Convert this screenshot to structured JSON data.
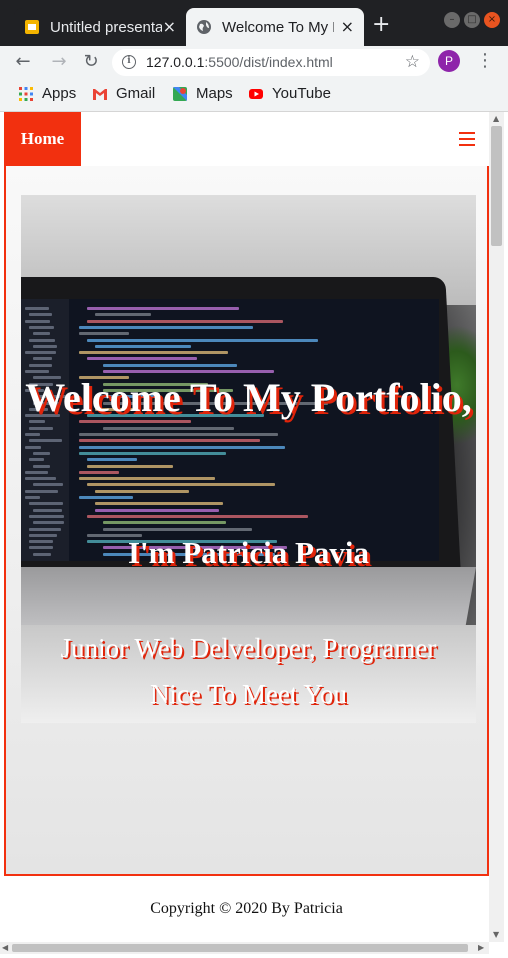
{
  "browser": {
    "tabs": [
      {
        "title": "Untitled presentation",
        "active": false,
        "icon": "slides-icon"
      },
      {
        "title": "Welcome To My Portfolio",
        "active": true,
        "icon": "globe-icon"
      }
    ],
    "new_tab": "+",
    "close_glyph": "×",
    "url_host": "127.0.0.1",
    "url_rest": ":5500/dist/index.html",
    "profile_initial": "P",
    "profile_color": "#8e24aa",
    "bookmarks": [
      {
        "label": "Apps",
        "icon": "apps-grid-icon"
      },
      {
        "label": "Gmail",
        "icon": "gmail-icon"
      },
      {
        "label": "Maps",
        "icon": "maps-icon"
      },
      {
        "label": "YouTube",
        "icon": "youtube-icon"
      }
    ]
  },
  "page": {
    "accent_color": "#f2300f",
    "nav": {
      "home_label": "Home",
      "menu_icon": "hamburger-icon"
    },
    "hero": {
      "line1": "Welcome To My Portfolio,",
      "line2": "I'm Patricia Pavia",
      "line3a": "Junior Web Delveloper, Programer",
      "line3b": "Nice To Meet You"
    },
    "footer": {
      "copyright": "Copyright © 2020 By Patricia"
    }
  }
}
